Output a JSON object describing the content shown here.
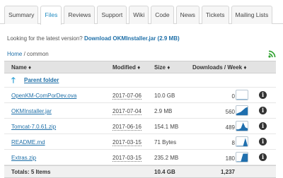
{
  "tabs": [
    {
      "label": "Summary"
    },
    {
      "label": "Files",
      "active": true
    },
    {
      "label": "Reviews"
    },
    {
      "label": "Support"
    },
    {
      "label": "Wiki"
    },
    {
      "label": "Code"
    },
    {
      "label": "News"
    },
    {
      "label": "Tickets"
    },
    {
      "label": "Mailing Lists"
    }
  ],
  "latest": {
    "prompt": "Looking for the latest version?",
    "link_text": "Download OKMInstaller.jar (2.9 MB)"
  },
  "breadcrumb": {
    "home": "Home",
    "separator": "/",
    "current": "common"
  },
  "table": {
    "headers": {
      "name": "Name ♦",
      "modified": "Modified ♦",
      "size": "Size ♦",
      "downloads": "Downloads / Week ♦"
    },
    "parent_label": "Parent folder",
    "rows": [
      {
        "name": "OpenKM-ComPorDev.ova",
        "modified": "2017-07-06",
        "size": "10.0 GB",
        "downloads": "0",
        "trend": [
          0,
          0,
          0,
          0,
          0,
          0
        ]
      },
      {
        "name": "OKMInstaller.jar",
        "modified": "2017-07-04",
        "size": "2.9 MB",
        "downloads": "560",
        "trend": [
          1,
          2,
          3,
          5,
          7,
          8
        ]
      },
      {
        "name": "Tomcat-7.0.61.zip",
        "modified": "2017-06-16",
        "size": "154.1 MB",
        "downloads": "489",
        "trend": [
          1,
          1,
          2,
          8,
          3,
          2
        ]
      },
      {
        "name": "README.md",
        "modified": "2017-03-15",
        "size": "71 Bytes",
        "downloads": "8",
        "trend": [
          0,
          0,
          0,
          0,
          1,
          0
        ]
      },
      {
        "name": "Extras.zip",
        "modified": "2017-03-15",
        "size": "235.2 MB",
        "downloads": "180",
        "trend": [
          0,
          0,
          0,
          1,
          1,
          1
        ]
      }
    ],
    "footer": {
      "label": "Totals: 5 Items",
      "size": "10.4 GB",
      "downloads": "1,237"
    }
  },
  "colors": {
    "link": "#1e6fa8",
    "active_tab": "#1f8bc1",
    "sparkline": "#1f6fae",
    "rss": "#2ca02c"
  }
}
